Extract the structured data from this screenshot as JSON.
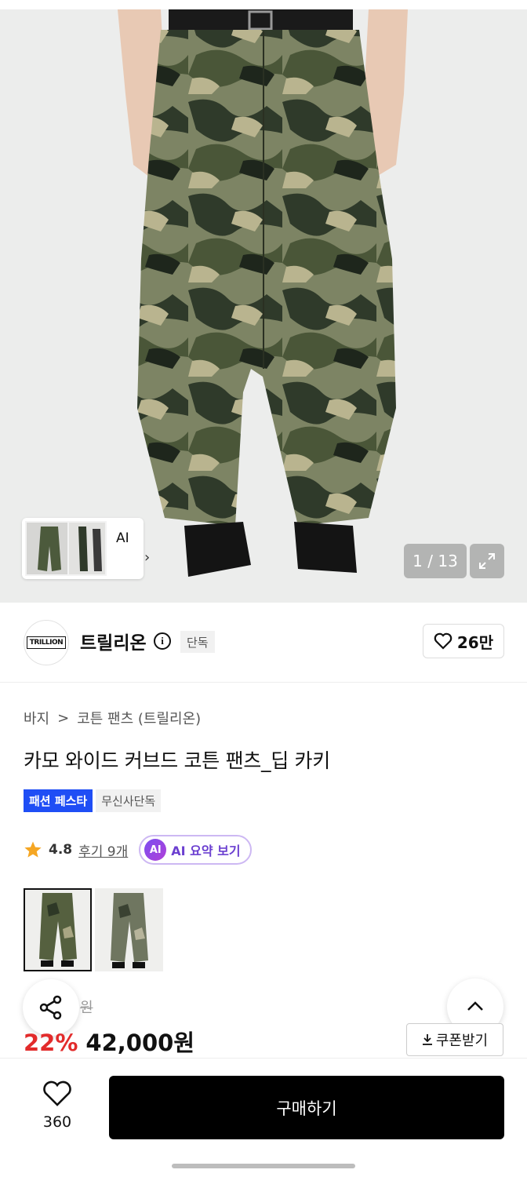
{
  "hero": {
    "counter": "1 / 13",
    "thumb_ai_label": "AI",
    "thumb_chevron": "›"
  },
  "brand": {
    "logo_text": "TRILLION",
    "name": "트릴리온",
    "exclusive_tag": "단독",
    "like_count": "26만"
  },
  "breadcrumb": {
    "category": "바지",
    "separator": ">",
    "subcategory": "코튼 팬츠 (트릴리온)"
  },
  "product": {
    "title": "카모 와이드 커브드 코튼 팬츠_딥 카키",
    "badges": [
      "패션 페스타",
      "무신사단독"
    ]
  },
  "rating": {
    "value": "4.8",
    "reviews": "후기 9개",
    "ai_badge": "AI",
    "ai_summary": "AI 요약 보기"
  },
  "price": {
    "original_partial": "원",
    "discount": "22%",
    "current": "42,000원",
    "coupon": "쿠폰받기"
  },
  "bottom": {
    "wish_count": "360",
    "buy_label": "구매하기"
  },
  "colors": {
    "accent_blue": "#1f4ef5",
    "discount_red": "#e22b2b",
    "ai_purple": "#6b3fd0"
  }
}
